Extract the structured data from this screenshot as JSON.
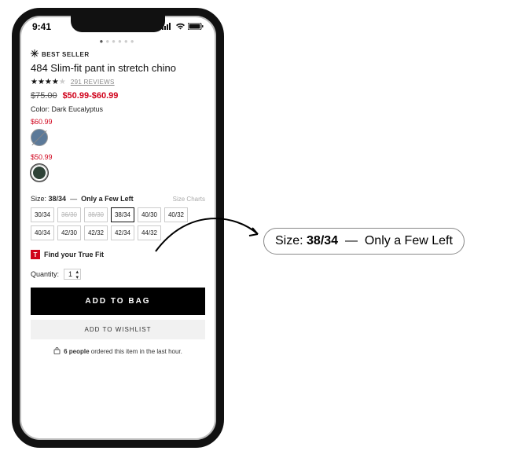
{
  "status": {
    "time": "9:41"
  },
  "badge": "BEST SELLER",
  "product": {
    "title": "484 Slim-fit pant in stretch chino",
    "reviews_label": "291 REVIEWS",
    "rating_filled": 4,
    "original_price": "$75.00",
    "sale_price": "$50.99-$60.99",
    "color_label": "Color:",
    "color_value": "Dark Eucalyptus"
  },
  "variants": [
    {
      "price": "$60.99",
      "color": "#5c7a99",
      "struck": true,
      "selected": false
    },
    {
      "price": "$50.99",
      "color": "#2e4237",
      "struck": false,
      "selected": true
    }
  ],
  "size": {
    "label": "Size:",
    "value": "38/34",
    "stock_msg": "Only a Few Left",
    "charts": "Size Charts",
    "options": [
      {
        "v": "30/34",
        "oos": false,
        "sel": false
      },
      {
        "v": "36/30",
        "oos": true,
        "sel": false
      },
      {
        "v": "38/30",
        "oos": true,
        "sel": false
      },
      {
        "v": "38/34",
        "oos": false,
        "sel": true
      },
      {
        "v": "40/30",
        "oos": false,
        "sel": false
      },
      {
        "v": "40/32",
        "oos": false,
        "sel": false
      },
      {
        "v": "40/34",
        "oos": false,
        "sel": false
      },
      {
        "v": "42/30",
        "oos": false,
        "sel": false
      },
      {
        "v": "42/32",
        "oos": false,
        "sel": false
      },
      {
        "v": "42/34",
        "oos": false,
        "sel": false
      },
      {
        "v": "44/32",
        "oos": false,
        "sel": false
      }
    ]
  },
  "truefit": "Find your True Fit",
  "quantity": {
    "label": "Quantity:",
    "value": "1"
  },
  "add_bag": "ADD TO BAG",
  "add_wish": "ADD TO WISHLIST",
  "social": {
    "count": "6 people",
    "rest": " ordered this item in the last hour."
  },
  "callout": {
    "label": "Size:",
    "value": "38/34",
    "sep": "—",
    "msg": "Only a Few Left"
  }
}
